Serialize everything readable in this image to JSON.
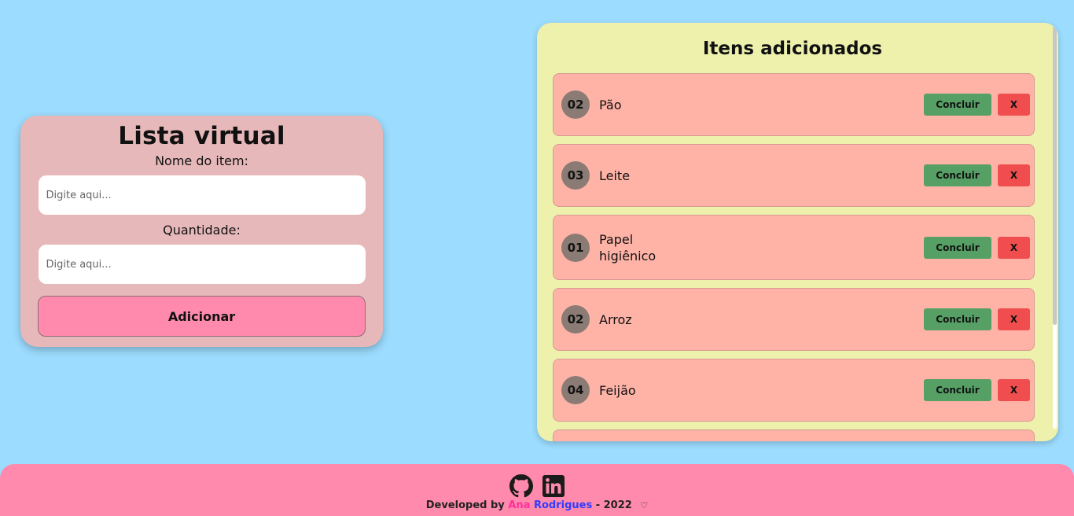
{
  "form": {
    "title": "Lista virtual",
    "name_label": "Nome do item:",
    "name_placeholder": "Digite aqui...",
    "qty_label": "Quantidade:",
    "qty_placeholder": "Digite aqui...",
    "add_button": "Adicionar"
  },
  "list": {
    "title": "Itens adicionados",
    "items": [
      {
        "qty": "02",
        "name": "Pão",
        "done": "Concluir",
        "delete": "X"
      },
      {
        "qty": "03",
        "name": "Leite",
        "done": "Concluir",
        "delete": "X"
      },
      {
        "qty": "01",
        "name": "Papel higiênico",
        "done": "Concluir",
        "delete": "X"
      },
      {
        "qty": "02",
        "name": "Arroz",
        "done": "Concluir",
        "delete": "X"
      },
      {
        "qty": "04",
        "name": "Feijão",
        "done": "Concluir",
        "delete": "X"
      }
    ]
  },
  "footer": {
    "icons": [
      "github-icon",
      "linkedin-icon"
    ],
    "prefix": "Developed by",
    "first_name": "Ana",
    "last_name": "Rodrigues",
    "suffix": "- 2022",
    "heart": "♡"
  },
  "colors": {
    "background": "#9cdcfe",
    "form_card": "#e7b8b9",
    "add_button": "#ff8aad",
    "list_panel": "#edf1ac",
    "item": "#ffb3a7",
    "done_button": "#56a066",
    "delete_button": "#f04e4e",
    "footer": "#ff8aad"
  }
}
